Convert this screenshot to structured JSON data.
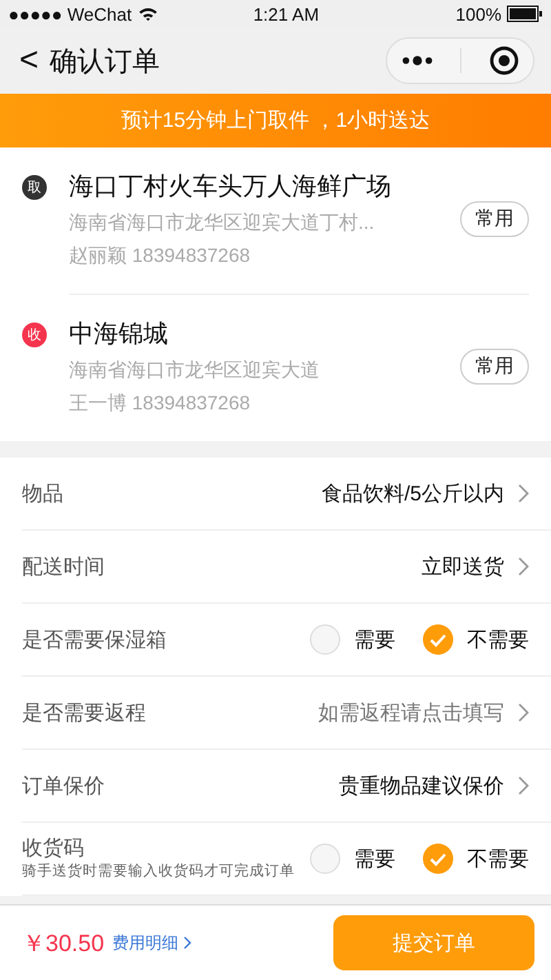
{
  "status_bar": {
    "carrier": "●●●●● WeChat",
    "time": "1:21 AM",
    "battery": "100%"
  },
  "nav": {
    "back": "<",
    "title": "确认订单"
  },
  "banner": {
    "text": "预计15分钟上门取件 ，1小时送达"
  },
  "addresses": [
    {
      "badge": "取",
      "color": "#333333",
      "name": "海口丁村火车头万人海鲜广场",
      "address": "海南省海口市龙华区迎宾大道丁村...",
      "contact": "赵丽颖 18394837268",
      "button": "常用"
    },
    {
      "badge": "收",
      "color": "#f5344d",
      "name": "中海锦城",
      "address": "海南省海口市龙华区迎宾大道",
      "contact": "王一博 18394837268",
      "button": "常用"
    }
  ],
  "rows": [
    {
      "kind": "link",
      "label": "物品",
      "value": "食品饮料/5公斤以内",
      "dimmed": false
    },
    {
      "kind": "link",
      "label": "配送时间",
      "value": "立即送货",
      "dimmed": false
    },
    {
      "kind": "choice",
      "label": "是否需要保湿箱",
      "options": [
        {
          "label": "需要",
          "selected": false
        },
        {
          "label": "不需要",
          "selected": true
        }
      ]
    },
    {
      "kind": "link",
      "label": "是否需要返程",
      "value": "如需返程请点击填写",
      "dimmed": true
    },
    {
      "kind": "link",
      "label": "订单保价",
      "value": "贵重物品建议保价",
      "dimmed": false
    },
    {
      "kind": "choice",
      "label": "收货码",
      "note": "骑手送货时需要输入收货码才可完成订单",
      "options": [
        {
          "label": "需要",
          "selected": false
        },
        {
          "label": "不需要",
          "selected": true
        }
      ]
    }
  ],
  "footer": {
    "price": "￥30.50",
    "details": "费用明细",
    "submit": "提交订单"
  }
}
